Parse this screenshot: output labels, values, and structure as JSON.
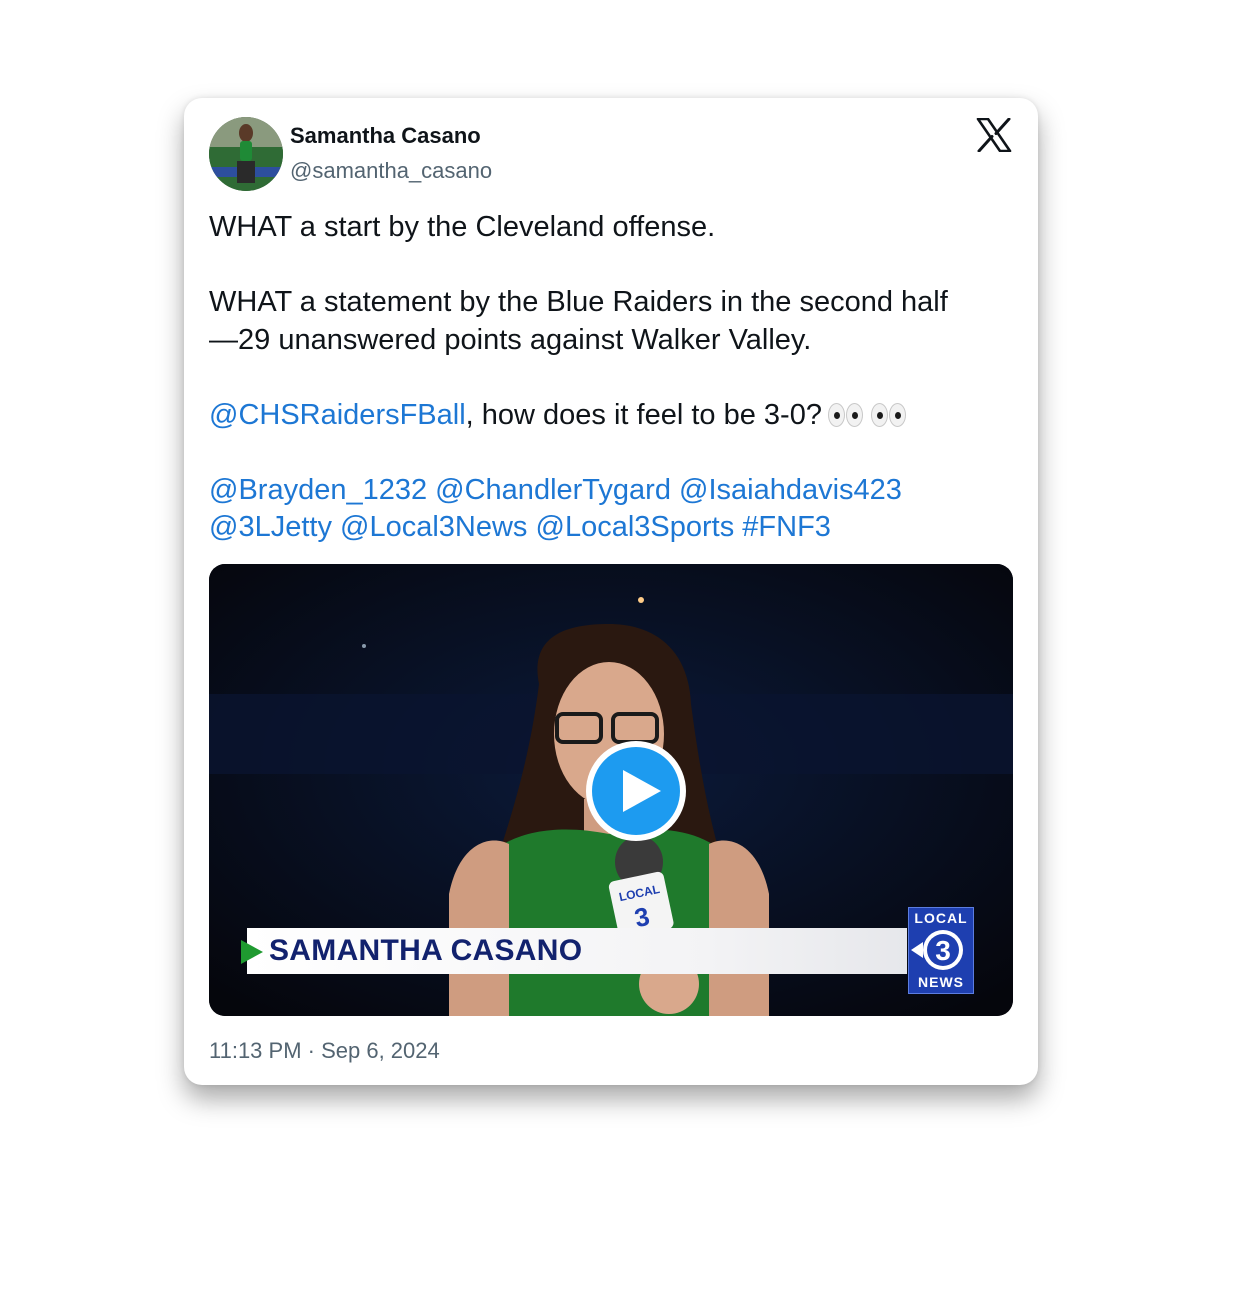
{
  "author": {
    "name": "Samantha Casano",
    "handle": "@samantha_casano"
  },
  "tweet": {
    "line1": "WHAT a start by the Cleveland offense.",
    "line2": "WHAT a statement by the Blue Raiders in the second half",
    "line3": "—29 unanswered points against Walker Valley.",
    "mention_team": "@CHSRaidersFBall",
    "question": ", how does it feel to be 3-0?",
    "emoji": "eyes",
    "tags_row1": [
      "@Brayden_1232",
      "@ChandlerTygard",
      "@Isaiahdavis423"
    ],
    "tags_row2": [
      "@3LJetty",
      "@Local3News",
      "@Local3Sports",
      "#FNF3"
    ]
  },
  "media": {
    "lower_third_name": "SAMANTHA CASANO",
    "mic_flag_top": "LOCAL",
    "mic_flag_number": "3",
    "station_logo_top": "LOCAL",
    "station_logo_number": "3",
    "station_logo_bottom": "NEWS",
    "play_icon": "play-icon"
  },
  "timestamp": "11:13 PM · Sep 6, 2024",
  "colors": {
    "link": "#1d77d4",
    "text": "#0f1419",
    "muted": "#536471",
    "play": "#1d9bf0",
    "station_blue": "#1e3fb0",
    "lower_third_text": "#12226e",
    "jersey_green": "#1f7a2c"
  }
}
